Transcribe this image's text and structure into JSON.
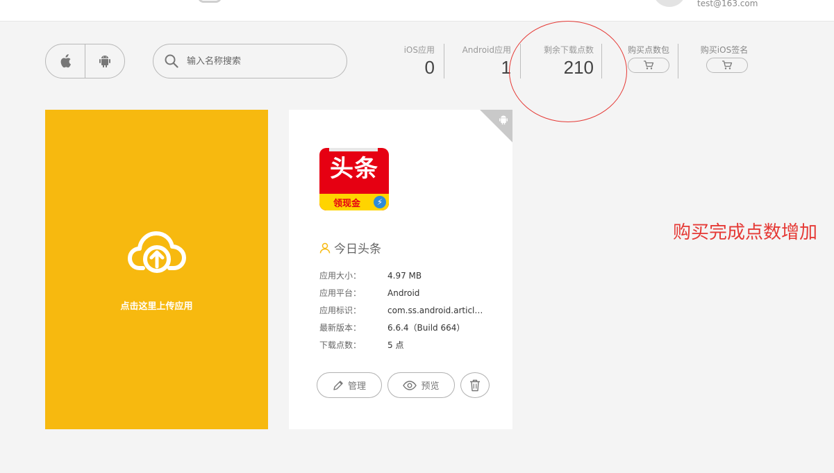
{
  "header": {
    "user_email": "test@163.com"
  },
  "toolbar": {
    "search_placeholder": "输入名称搜索"
  },
  "stats": {
    "ios_apps": {
      "label": "iOS应用",
      "value": "0"
    },
    "android_apps": {
      "label": "Android应用",
      "value": "1"
    },
    "remaining_downloads": {
      "label": "剩余下载点数",
      "value": "210"
    },
    "buy_points": {
      "label": "购买点数包"
    },
    "buy_ios_sign": {
      "label": "购买iOS签名"
    }
  },
  "upload": {
    "label": "点击这里上传应用"
  },
  "app": {
    "icon_title": "头条",
    "icon_subtitle": "领现金",
    "name": "今日头条",
    "fields": [
      {
        "key": "应用大小：",
        "value": "4.97 MB"
      },
      {
        "key": "应用平台：",
        "value": "Android"
      },
      {
        "key": "应用标识：",
        "value": "com.ss.android.article..."
      },
      {
        "key": "最新版本：",
        "value": "6.6.4（Build 664）"
      },
      {
        "key": "下载点数：",
        "value": "5 点"
      }
    ],
    "actions": {
      "manage": "管理",
      "preview": "预览"
    }
  },
  "annotation": {
    "text": "购买完成点数增加",
    "color": "#e53935"
  },
  "colors": {
    "upload_card": "#f7b90f",
    "background": "#f4f4f4"
  },
  "icons": [
    "apple-icon",
    "android-icon",
    "search-icon",
    "cart-icon",
    "cloud-upload-icon",
    "user-icon",
    "pencil-icon",
    "eye-icon",
    "trash-icon"
  ]
}
